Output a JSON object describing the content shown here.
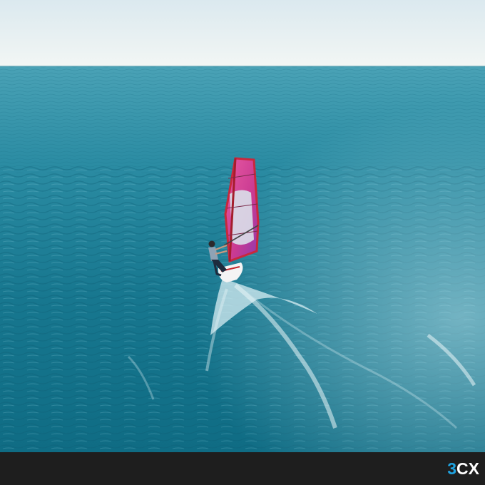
{
  "photo": {
    "scene": "windsurfer-on-open-sea",
    "colors": {
      "sky_top": "#e3eef2",
      "sky_horizon": "#f1f6f5",
      "sea_far": "#3f9bb0",
      "sea_mid": "#1f8197",
      "sea_near": "#106a82",
      "sail_pink": "#d63f8e",
      "sail_red": "#c8283c",
      "sail_window": "#d9dde8"
    }
  },
  "footer": {
    "background": "#1e1e1e",
    "logo": {
      "digit": "3",
      "letters": "CX",
      "digit_color": "#1fa3e0",
      "letters_color": "#ffffff"
    }
  }
}
